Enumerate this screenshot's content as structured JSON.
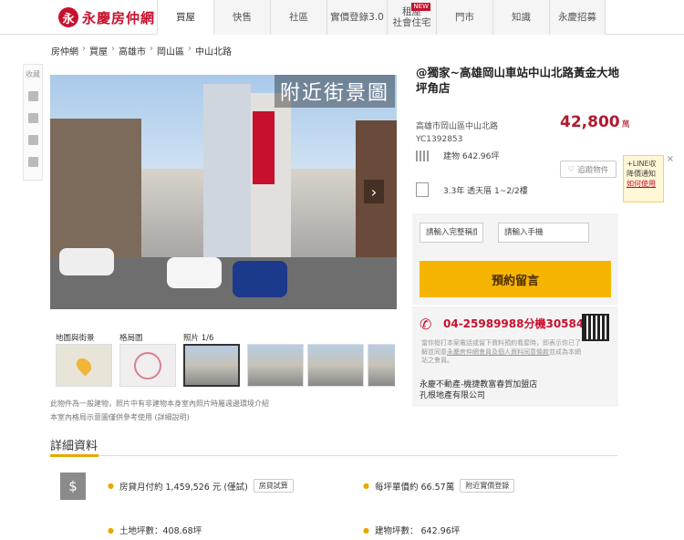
{
  "header": {
    "logo_mark": "永",
    "logo_text": "永慶房仲網",
    "nav": [
      {
        "label": "買屋"
      },
      {
        "label": "快售"
      },
      {
        "label": "社區"
      },
      {
        "label": "實價登錄3.0"
      },
      {
        "label": "租屋\n社會住宅",
        "badge": "NEW"
      },
      {
        "label": "門市"
      },
      {
        "label": "知識"
      },
      {
        "label": "永慶招募"
      }
    ]
  },
  "breadcrumb": [
    "房仲網",
    "買屋",
    "高雄市",
    "岡山區",
    "中山北路"
  ],
  "side_tools": {
    "label": "收藏"
  },
  "photo": {
    "caption": "附近街景圖",
    "counter": "照片 1/6",
    "tabs": {
      "map_label": "地圖與街景",
      "plan_label": "格局圖",
      "photo_label": "照片 1/6"
    }
  },
  "notes": {
    "line1": "此物件為一般建物，照片中有非建物本身室內照片時屬週邊環境介紹",
    "line2": "本室內格局示意圖僅供參考使用 (詳細說明)"
  },
  "listing": {
    "title": "@獨家~高雄岡山車站中山北路黃金大地坪角店",
    "address": "高雄市岡山區中山北路",
    "code": "YC1392853",
    "price": "42,800",
    "price_unit": "萬",
    "building_area": "建物 642.96坪",
    "layout": "3.3年 透天厝 1~2/2樓",
    "fav_label": "追蹤物件"
  },
  "form": {
    "name_placeholder": "請輸入完整稱謂",
    "phone_placeholder": "請輸入手機",
    "submit_label": "預約留言"
  },
  "contact": {
    "phone": "04-25989988分機30584",
    "disclaimer_a": "當你撥打本案電話或留下資料預約看屋時，即表示你已了解並同意",
    "disclaimer_link": "永慶房仲網會員及個人資料同意條款",
    "disclaimer_b": "並成為本網站之會員。",
    "agency_line1": "永慶不動產-機捷教富春賀加盟店",
    "agency_line2": "孔根地產有限公司"
  },
  "line_promo": {
    "text": "+LINE収降價通知",
    "link": "如何使用",
    "close": "×"
  },
  "details": {
    "section_title": "詳細資料",
    "monthly_label": "房貸月付約 1,459,526 元 (僅試)",
    "monthly_btn": "房貸試算",
    "unit_price_label": "每坪單價約 66.57萬",
    "unit_price_btn": "附近實價登錄",
    "land_area": "土地坪數：408.68坪",
    "bldg_area": "建物坪數： 642.96坪"
  },
  "colors": {
    "brand": "#c8102e",
    "accent": "#f5b400"
  }
}
